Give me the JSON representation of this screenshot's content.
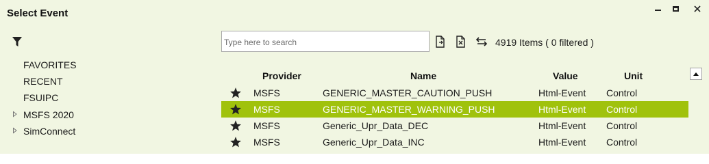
{
  "window": {
    "title": "Select Event"
  },
  "left_pane": {
    "tree": [
      {
        "label": "FAVORITES",
        "expandable": false
      },
      {
        "label": "RECENT",
        "expandable": false
      },
      {
        "label": "FSUIPC",
        "expandable": false
      },
      {
        "label": "MSFS 2020",
        "expandable": true
      },
      {
        "label": "SimConnect",
        "expandable": true
      }
    ]
  },
  "toolbar": {
    "search_placeholder": "Type here to search",
    "search_value": "",
    "item_count": "4919 Items ( 0 filtered )"
  },
  "table": {
    "columns": {
      "provider": "Provider",
      "name": "Name",
      "value": "Value",
      "unit": "Unit"
    },
    "rows": [
      {
        "provider": "MSFS",
        "name": "GENERIC_MASTER_CAUTION_PUSH",
        "value": "Html-Event",
        "unit": "Control",
        "selected": false
      },
      {
        "provider": "MSFS",
        "name": "GENERIC_MASTER_WARNING_PUSH",
        "value": "Html-Event",
        "unit": "Control",
        "selected": true
      },
      {
        "provider": "MSFS",
        "name": "Generic_Upr_Data_DEC",
        "value": "Html-Event",
        "unit": "Control",
        "selected": false
      },
      {
        "provider": "MSFS",
        "name": "Generic_Upr_Data_INC",
        "value": "Html-Event",
        "unit": "Control",
        "selected": false
      }
    ]
  },
  "colors": {
    "panel_background": "#f1f6e2",
    "selection": "#a0c20c",
    "selection_text": "#ffffff"
  }
}
